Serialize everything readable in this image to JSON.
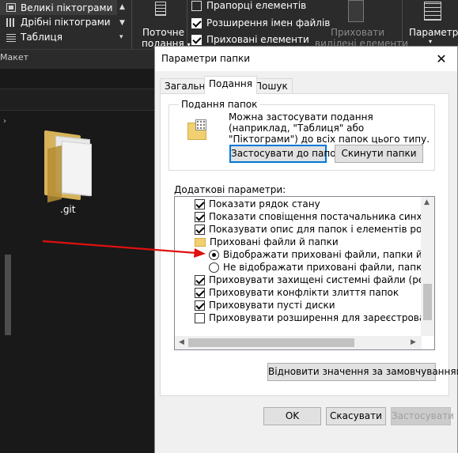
{
  "ribbon": {
    "layout_options": [
      "Великі піктограми",
      "Дрібні піктограми",
      "Таблиця"
    ],
    "current_view_label": [
      "Поточне",
      "подання"
    ],
    "show_hide": [
      "Прапорці елементів",
      "Розширення імен файлів",
      "Приховані елементи"
    ],
    "hide_selected_label": [
      "Приховати",
      "виділені елементи"
    ],
    "options_label": "Параметри",
    "group_label": "Макет"
  },
  "folder": {
    "name": ".git"
  },
  "dialog": {
    "title": "Параметри папки",
    "tabs": [
      "Загальні",
      "Подання",
      "Пошук"
    ],
    "active_tab": "Подання",
    "folder_views": {
      "label": "Подання папок",
      "description": "Можна застосувати подання (наприклад, \"Таблиця\" або \"Піктограми\") до всіх папок цього типу.",
      "apply_button": "Застосувати до папок",
      "reset_button": "Скинути папки"
    },
    "advanced": {
      "label": "Додаткові параметри:",
      "items": [
        {
          "type": "checkbox",
          "checked": true,
          "label": "Показати рядок стану"
        },
        {
          "type": "checkbox",
          "checked": true,
          "label": "Показати сповіщення постачальника синхронізації"
        },
        {
          "type": "checkbox",
          "checked": true,
          "label": "Показувати опис для папок і елементів робочого сто"
        },
        {
          "type": "folder",
          "label": "Приховані файли й папки"
        },
        {
          "type": "radio",
          "checked": true,
          "label": "Відображати приховані файли, папки й диски"
        },
        {
          "type": "radio",
          "checked": false,
          "label": "Не відображати приховані файли, папки й диски"
        },
        {
          "type": "checkbox",
          "checked": true,
          "label": "Приховувати захищені системні файли (рекомендова"
        },
        {
          "type": "checkbox",
          "checked": true,
          "label": "Приховувати конфлікти злиття папок"
        },
        {
          "type": "checkbox",
          "checked": true,
          "label": "Приховувати пусті диски"
        },
        {
          "type": "checkbox",
          "checked": false,
          "label": "Приховувати розширення для зареєстрованих типів ф"
        }
      ]
    },
    "restore_defaults_button": "Відновити значення за замовчуванням",
    "ok_button": "OK",
    "cancel_button": "Скасувати",
    "apply_button": "Застосувати"
  }
}
